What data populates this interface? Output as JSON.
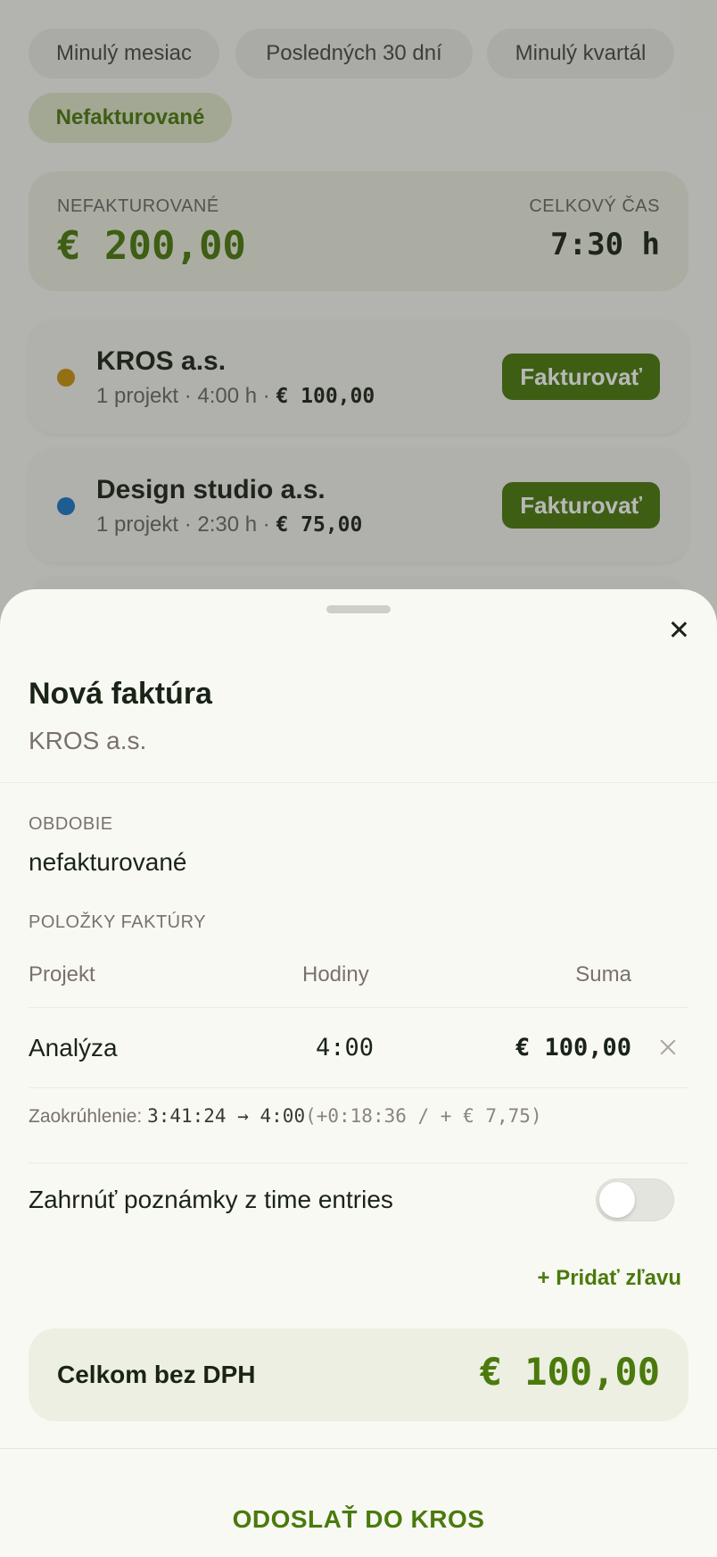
{
  "filters": {
    "chips": [
      {
        "label": "Minulý mesiac",
        "active": false
      },
      {
        "label": "Posledných 30 dní",
        "active": false
      },
      {
        "label": "Minulý kvartál",
        "active": false
      },
      {
        "label": "Nefakturované",
        "active": true
      }
    ]
  },
  "summary": {
    "label": "NEFAKTUROVANÉ",
    "amount": "€ 200,00",
    "time_label": "CELKOVÝ ČAS",
    "time": "7:30 h"
  },
  "clients": [
    {
      "name": "KROS a.s.",
      "meta": "1 projekt · 4:00 h · ",
      "amount": "€ 100,00",
      "dot_color": "#c8940c",
      "button": "Fakturovať"
    },
    {
      "name": "Design studio a.s.",
      "meta": "1 projekt · 2:30 h · ",
      "amount": "€ 75,00",
      "dot_color": "#1a76c8",
      "button": "Fakturovať"
    }
  ],
  "sheet": {
    "title": "Nová faktúra",
    "client": "KROS a.s.",
    "period_label": "OBDOBIE",
    "period": "nefakturované",
    "items_label": "POLOŽKY FAKTÚRY",
    "columns": {
      "project": "Projekt",
      "hours": "Hodiny",
      "sum": "Suma"
    },
    "items": [
      {
        "project": "Analýza",
        "hours": "4:00",
        "sum": "€ 100,00"
      }
    ],
    "rounding": {
      "label": "Zaokrúhlenie: ",
      "value": "3:41:24 → 4:00",
      "delta": "(+0:18:36 / + € 7,75)"
    },
    "notes_toggle": {
      "label": "Zahrnúť poznámky z time entries",
      "on": false
    },
    "add_discount": "+ Pridať zľavu",
    "total": {
      "label": "Celkom bez DPH",
      "amount": "€ 100,00"
    },
    "send": "ODOSLAŤ DO KROS"
  },
  "colors": {
    "accent": "#4a7a0c",
    "accent_soft": "#ecefe2"
  }
}
